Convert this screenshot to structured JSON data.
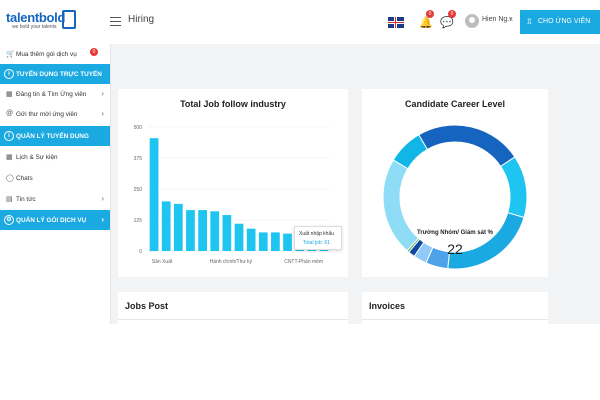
{
  "header": {
    "logo_name": "talentbold",
    "logo_tagline": "we bold your talents",
    "page_title": "Hiring",
    "notifications_count": "0",
    "messages_count": "0",
    "user_name": "Hien Ng...",
    "cta_label": "CHO ỨNG VIÊN"
  },
  "sidebar": {
    "buy_label": "Mua thêm gói dịch vụ",
    "buy_badge": "0",
    "sec1": "TUYỂN DỤNG TRỰC TUYẾN",
    "item_post": "Đăng tin & Tìm Ứng viên",
    "item_invite": "Gửi thư mời ứng viên",
    "sec2": "QUẢN LÝ TUYỂN DỤNG",
    "item_calendar": "Lịch & Sự kiện",
    "item_chats": "Chats",
    "item_news": "Tin tức",
    "sec3": "QUẢN LÝ GÓI DỊCH VỤ"
  },
  "cards": {
    "bar_title": "Total Job follow industry",
    "donut_title": "Candidate Career Level",
    "jobs_title": "Jobs Post",
    "invoices_title": "Invoices"
  },
  "chart_data": [
    {
      "type": "bar",
      "title": "Total Job follow industry",
      "categories": [
        "Sản Xuất",
        "",
        "",
        "",
        "",
        "",
        "Hành chính/Thư ký",
        "",
        "",
        "",
        "",
        "",
        "CNTT-Phần mềm",
        "",
        ""
      ],
      "values": [
        455,
        200,
        190,
        165,
        165,
        160,
        145,
        110,
        90,
        75,
        75,
        70,
        65,
        65,
        65
      ],
      "yticks": [
        0,
        125,
        250,
        375,
        500
      ],
      "ylim": [
        0,
        500
      ],
      "color": "#1ec5f0",
      "tooltip": {
        "category": "Xuất nhập khẩu",
        "label": "Total job: 61"
      }
    },
    {
      "type": "pie",
      "title": "Candidate Career Level",
      "center_label": "Trưởng Nhóm/ Giám sát %",
      "center_value": "22",
      "values": [
        24,
        14,
        22,
        5,
        3,
        1.5,
        0.5,
        22,
        8
      ],
      "colors": [
        "#1565c0",
        "#1ec5f0",
        "#1aa9e0",
        "#4ea3e8",
        "#90caf9",
        "#0d47a1",
        "#4caf50",
        "#8fdcf7",
        "#0fb6e6"
      ]
    }
  ]
}
